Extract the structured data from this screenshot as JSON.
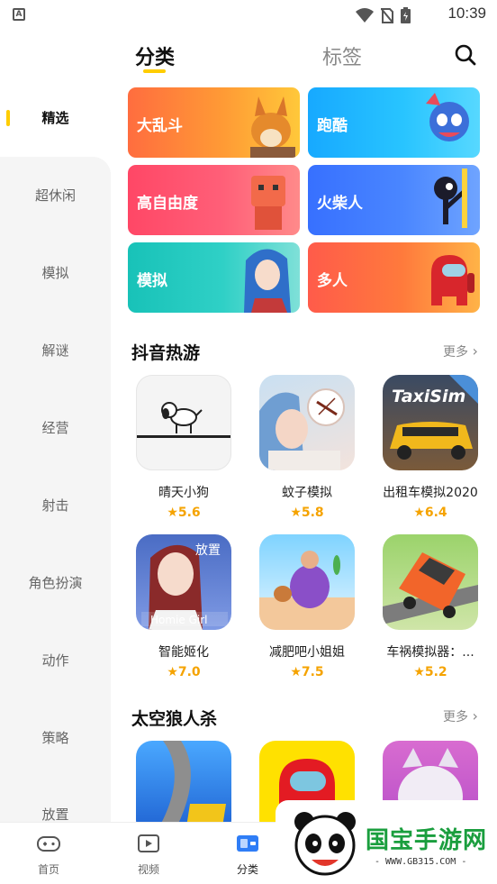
{
  "status_bar": {
    "badge": "A",
    "time": "10:39"
  },
  "top_tabs": {
    "active": "分类",
    "other": "标签"
  },
  "sidebar": {
    "items": [
      {
        "label": "精选"
      },
      {
        "label": "超休闲"
      },
      {
        "label": "模拟"
      },
      {
        "label": "解谜"
      },
      {
        "label": "经营"
      },
      {
        "label": "射击"
      },
      {
        "label": "角色扮演"
      },
      {
        "label": "动作"
      },
      {
        "label": "策略"
      },
      {
        "label": "放置"
      }
    ]
  },
  "category_cards": [
    {
      "label": "大乱斗",
      "color": "#ff7a3c"
    },
    {
      "label": "跑酷",
      "color": "#1fb6ff"
    },
    {
      "label": "高自由度",
      "color": "#ff4f6e"
    },
    {
      "label": "火柴人",
      "color": "#3a7bff"
    },
    {
      "label": "模拟",
      "color": "#1dc7c2"
    },
    {
      "label": "多人",
      "color": "#ff6a3d"
    }
  ],
  "sections": [
    {
      "title": "抖音热游",
      "more": "更多",
      "games": [
        {
          "name": "晴天小狗",
          "rating": "5.6"
        },
        {
          "name": "蚊子模拟",
          "rating": "5.8"
        },
        {
          "name": "出租车模拟2020",
          "rating": "6.4"
        },
        {
          "name": "智能姬化",
          "rating": "7.0"
        },
        {
          "name": "减肥吧小姐姐",
          "rating": "7.5"
        },
        {
          "name": "车祸模拟器：...",
          "rating": "5.2"
        }
      ]
    },
    {
      "title": "太空狼人杀",
      "more": "更多"
    }
  ],
  "game_icon_text": {
    "taxi": "TaxiSim",
    "homie": "Homie Girl",
    "homie_badge": "放置"
  },
  "bottom_nav": [
    {
      "label": "首页",
      "icon": "gamepad-icon"
    },
    {
      "label": "视频",
      "icon": "video-icon"
    },
    {
      "label": "分类",
      "icon": "category-icon"
    }
  ],
  "watermark": {
    "text": "国宝手游网",
    "url": "- WWW.GB315.COM -"
  },
  "colors": {
    "accent": "#ffcd00",
    "rating": "#f5a300",
    "watermark_green": "#1a9e3e"
  }
}
